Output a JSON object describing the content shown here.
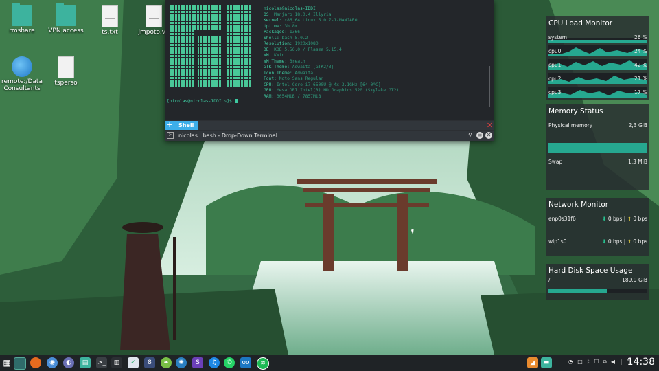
{
  "desktop": {
    "icons": [
      {
        "label": "rmshare"
      },
      {
        "label": "VPN access"
      },
      {
        "label": "ts.txt"
      },
      {
        "label": "jmpoto.vo"
      },
      {
        "label": "remote:/Data Consultants"
      },
      {
        "label": "tsperso"
      }
    ]
  },
  "terminal": {
    "sysinfo": {
      "user": "nicolas@nicolas-IDDI",
      "os": "Manjaro 18.0.4 Illyria",
      "kernel": "x86_64 Linux 5.0.7-1-MANJARO",
      "uptime": "3h 8m",
      "packages": "1366",
      "shell": "bash 5.0.2",
      "resolution": "1920x1080",
      "de": "KDE 5.56.0 / Plasma 5.15.4",
      "wm": "KWin",
      "wm_theme": "Breath",
      "gtk_theme": "Adwaita [GTK2/3]",
      "icon_theme": "Adwaita",
      "font": "Noto Sans Regular",
      "cpu": "Intel Core i7-6500U @ 4x 3.1GHz [64.0°C]",
      "gpu": "Mesa DRI Intel(R) HD Graphics 520 (Skylake GT2)",
      "ram": "3054MiB / 7857MiB"
    },
    "prompt": "[nicolas@nicolas-IDDI ~]$",
    "tab_label": "Shell",
    "window_title": "nicolas : bash - Drop-Down Terminal"
  },
  "cpu_widget": {
    "title": "CPU Load Monitor",
    "rows": [
      {
        "label": "system",
        "value": "26 %",
        "load": 0.26
      },
      {
        "label": "cpu0",
        "value": "24 %",
        "load": 0.24
      },
      {
        "label": "cpu1",
        "value": "42 %",
        "load": 0.42
      },
      {
        "label": "cpu2",
        "value": "21 %",
        "load": 0.21
      },
      {
        "label": "cpu3",
        "value": "17 %",
        "load": 0.17
      }
    ]
  },
  "memory_widget": {
    "title": "Memory Status",
    "physical_label": "Physical memory",
    "physical_value": "2,3 GiB",
    "physical_fraction": 1.0,
    "swap_label": "Swap",
    "swap_value": "1,3 MiB"
  },
  "network_widget": {
    "title": "Network Monitor",
    "interfaces": [
      {
        "name": "enp0s31f6",
        "down": "0 bps",
        "up": "0 bps"
      },
      {
        "name": "wlp1s0",
        "down": "0 bps",
        "up": "0 bps"
      }
    ],
    "separator": "|"
  },
  "disk_widget": {
    "title": "Hard Disk Space Usage",
    "mount": "/",
    "value": "189,9 GiB",
    "fraction": 0.59
  },
  "taskbar": {
    "clock": "14:38"
  },
  "colors": {
    "accent": "#26a890",
    "terminal_text": "#3ec9a0",
    "kde_blue": "#3daee9"
  }
}
